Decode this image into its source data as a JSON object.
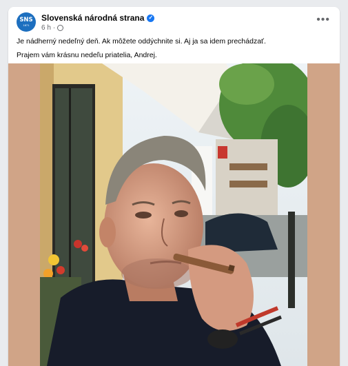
{
  "post": {
    "page_name": "Slovenská národná strana",
    "avatar_text": "SNS",
    "avatar_year": "1871",
    "timestamp": "6 h",
    "separator": "·",
    "lines": [
      "Je nádherný nedeľný deň. Ak môžete oddýchnite si. Aj ja sa idem prechádzať.",
      "Prajem vám krásnu nedeľu priatelia, Andrej."
    ]
  },
  "icons": {
    "verified": "verified-badge-icon",
    "audience": "globe-icon",
    "more": "more-options-icon"
  },
  "colors": {
    "accent": "#1877f2",
    "avatar_bg": "#1d6fbf",
    "media_bg": "#d0a487"
  }
}
